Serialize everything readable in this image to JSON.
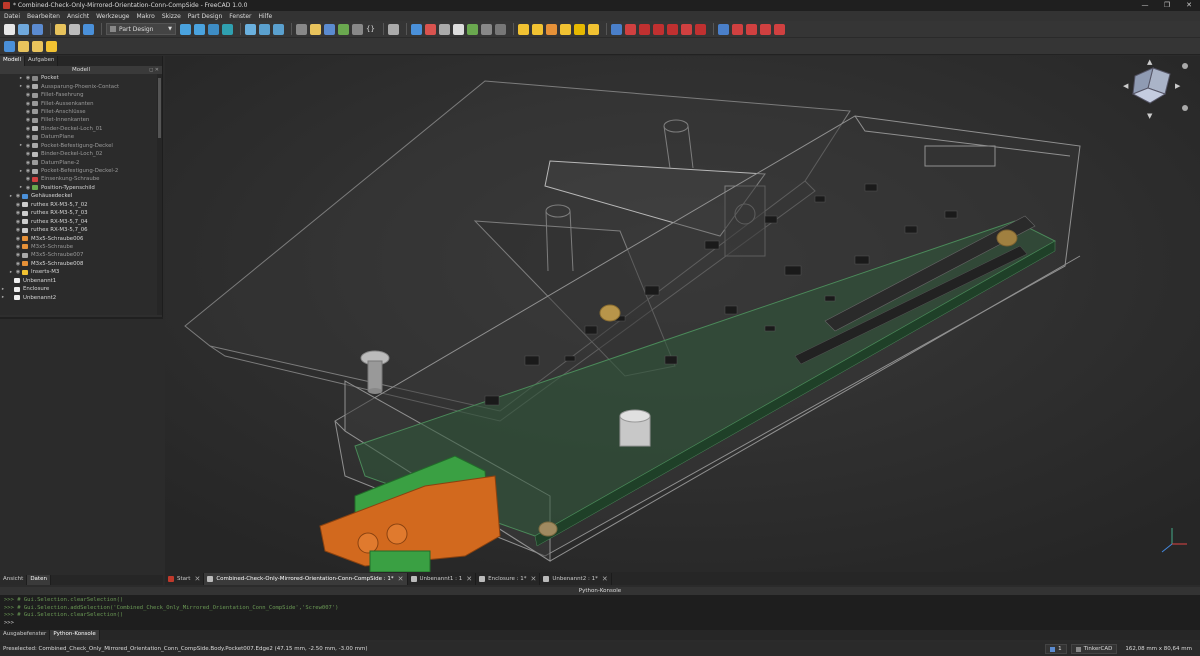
{
  "window": {
    "title": "* Combined-Check-Only-Mirrored-Orientation-Conn-CompSide - FreeCAD 1.0.0",
    "minimize": "—",
    "maximize": "❐",
    "close": "✕"
  },
  "menu": [
    "Datei",
    "Bearbeiten",
    "Ansicht",
    "Werkzeuge",
    "Makro",
    "Skizze",
    "Part Design",
    "Fenster",
    "Hilfe"
  ],
  "toolbar": {
    "workbench": "Part Design",
    "braces": "{}"
  },
  "left_panel": {
    "tabs": [
      "Modell",
      "Aufgaben"
    ],
    "tree_header": "Modell",
    "tree": [
      {
        "label": "Pocket",
        "dim": false,
        "arrow": "▸"
      },
      {
        "label": "Aussparung-Phoenix-Contact",
        "dim": true,
        "arrow": "▸"
      },
      {
        "label": "Fillet-Fasehrung",
        "dim": true,
        "arrow": ""
      },
      {
        "label": "Fillet-Aussenkanten",
        "dim": true,
        "arrow": ""
      },
      {
        "label": "Fillet-Anschlüsse",
        "dim": true,
        "arrow": ""
      },
      {
        "label": "Fillet-Innenkanten",
        "dim": true,
        "arrow": ""
      },
      {
        "label": "Binder-Deckel-Loch_01",
        "dim": true,
        "arrow": ""
      },
      {
        "label": "DatumPlane",
        "dim": true,
        "arrow": ""
      },
      {
        "label": "Pocket-Befestigung-Deckel",
        "dim": true,
        "arrow": "▸"
      },
      {
        "label": "Binder-Deckel-Loch_02",
        "dim": true,
        "arrow": ""
      },
      {
        "label": "DatumPlane-2",
        "dim": true,
        "arrow": ""
      },
      {
        "label": "Pocket-Befestigung-Deckel-2",
        "dim": true,
        "arrow": "▸"
      },
      {
        "label": "Einsenkung-Schraube",
        "dim": true,
        "arrow": ""
      },
      {
        "label": "Position-Typenschild",
        "dim": false,
        "arrow": "▸"
      },
      {
        "label": "Gehäusedeckel",
        "dim": false,
        "arrow": "▸"
      },
      {
        "label": "ruthex RX-M3-5,7_02",
        "dim": false,
        "arrow": ""
      },
      {
        "label": "ruthex RX-M3-5,7_03",
        "dim": false,
        "arrow": ""
      },
      {
        "label": "ruthex RX-M3-5,7_04",
        "dim": false,
        "arrow": ""
      },
      {
        "label": "ruthex RX-M3-5,7_06",
        "dim": false,
        "arrow": ""
      },
      {
        "label": "M3x5-Schraube006",
        "dim": false,
        "arrow": ""
      },
      {
        "label": "M3x5-Schraube",
        "dim": true,
        "arrow": ""
      },
      {
        "label": "M3x5-Schraube007",
        "dim": true,
        "arrow": ""
      },
      {
        "label": "M3x5-Schraube008",
        "dim": false,
        "arrow": ""
      },
      {
        "label": "Inserts-M3",
        "dim": false,
        "arrow": "▸"
      },
      {
        "label": "Unbenannt1",
        "dim": false,
        "arrow": ""
      },
      {
        "label": "Enclosure",
        "dim": false,
        "arrow": "▸"
      },
      {
        "label": "Unbenannt2",
        "dim": false,
        "arrow": "▸"
      }
    ],
    "bottom_tabs": [
      "Ansicht",
      "Daten"
    ]
  },
  "doc_tabs": [
    {
      "label": "Start",
      "active": false
    },
    {
      "label": "Combined-Check-Only-Mirrored-Orientation-Conn-CompSide : 1*",
      "active": true
    },
    {
      "label": "Unbenannt1 : 1",
      "active": false
    },
    {
      "label": "Enclosure : 1*",
      "active": false
    },
    {
      "label": "Unbenannt2 : 1*",
      "active": false
    }
  ],
  "console": {
    "title": "Python-Konsole",
    "lines": [
      ">>> # Gui.Selection.clearSelection()",
      ">>> # Gui.Selection.addSelection('Combined_Check_Only_Mirrored_Orientation_Conn_CompSide','Screw007')",
      ">>> # Gui.Selection.clearSelection()",
      ">>>"
    ],
    "tabs": [
      "Ausgabefenster",
      "Python-Konsole"
    ]
  },
  "status": {
    "message": "Preselected: Combined_Check_Only_Mirrored_Orientation_Conn_CompSide.Body.Pocket007.Edge2 (47.15 mm, -2.50 mm, -3.00 mm)",
    "page": "1",
    "nav_style": "TinkerCAD",
    "dimensions": "162,08 mm x 80,64 mm"
  },
  "colors": {
    "accent": "#3c4452",
    "pcb": "#2f5a3a",
    "connector_orange": "#d2691e",
    "connector_green": "#3aa043"
  }
}
